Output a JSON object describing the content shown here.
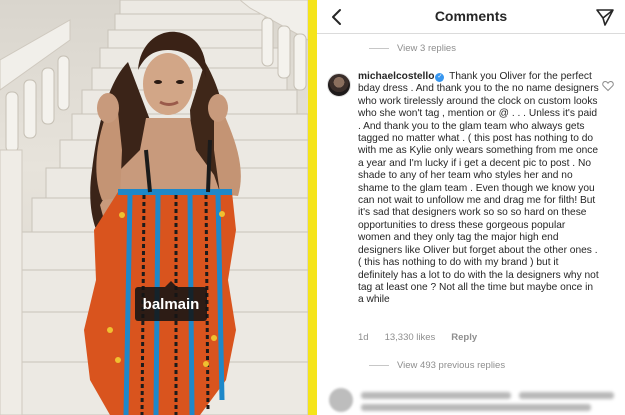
{
  "photo": {
    "tag_label": "balmain"
  },
  "header": {
    "title": "Comments",
    "back_icon": "chevron-left-icon",
    "share_icon": "paper-plane-icon"
  },
  "thread": {
    "view_replies_top": "View 3 replies",
    "comment": {
      "username": "michaelcostello",
      "verified": true,
      "text": "Thank you Oliver for the perfect bday dress . And thank you to the no name designers who work tirelessly around the clock on custom looks who she won't tag , mention or @ . . . Unless it's paid . And thank you to the glam team who always gets tagged no matter what . ( this post has nothing to do with me as Kylie only wears something from me once a year and I'm lucky if i get a decent pic to post . No shade to any of her team who styles her and no shame to the glam team . Even though we know you can not wait to unfollow me and drag me for filth! But it's sad that designers work so so so hard on these opportunities to dress these gorgeous popular women and they only tag the major high end designers like Oliver but forget about the other ones . ( this has nothing to do with my brand ) but it definitely has a lot to do with the la designers why not tag at least one ? Not all the time but maybe once in a while",
      "age": "1d",
      "likes": "13,330 likes",
      "reply_label": "Reply"
    },
    "view_replies_bottom": "View 493 previous replies"
  },
  "colors": {
    "divider": "#f5e419",
    "verified": "#3897f0",
    "meta_text": "#8e8e8e"
  }
}
